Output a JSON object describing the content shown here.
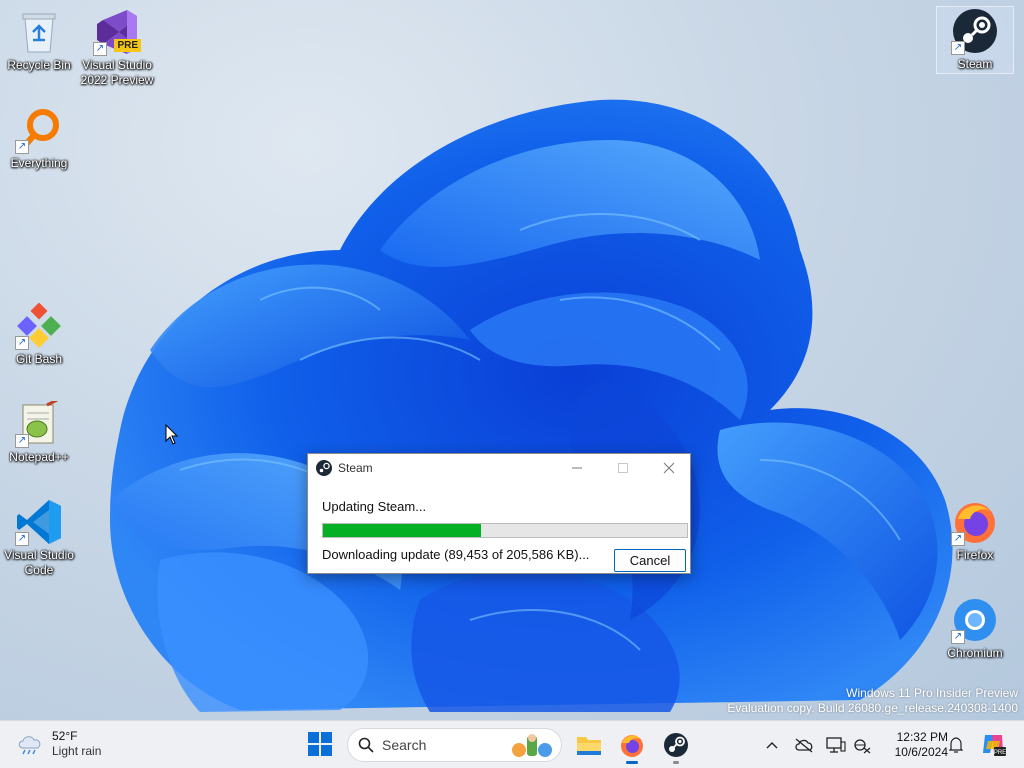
{
  "desktop": {
    "icons": [
      {
        "label": "Recycle Bin",
        "icon": "recycle-bin-icon"
      },
      {
        "label": "Visual Studio\n2022 Preview",
        "icon": "visual-studio-icon",
        "badge": "PRE"
      },
      {
        "label": "Everything",
        "icon": "everything-search-icon"
      },
      {
        "label": "Git Bash",
        "icon": "git-bash-icon"
      },
      {
        "label": "Notepad++",
        "icon": "notepad-plus-plus-icon"
      },
      {
        "label": "Visual Studio\nCode",
        "icon": "vscode-icon"
      },
      {
        "label": "Steam",
        "icon": "steam-icon"
      },
      {
        "label": "Firefox",
        "icon": "firefox-icon"
      },
      {
        "label": "Chromium",
        "icon": "chromium-icon"
      }
    ],
    "watermark": {
      "line1": "Windows 11 Pro Insider Preview",
      "line2": "Evaluation copy. Build 26080.ge_release.240308-1400"
    }
  },
  "steam_dialog": {
    "title": "Steam",
    "status": "Updating Steam...",
    "progress": 0.4351,
    "detail": "Downloading update (89,453 of 205,586 KB)...",
    "cancel_label": "Cancel",
    "progress_color": "#06b025"
  },
  "taskbar": {
    "weather": {
      "temp": "52°F",
      "condition": "Light rain"
    },
    "search_label": "Search",
    "apps": [
      "file-explorer-icon",
      "firefox-icon",
      "steam-icon"
    ],
    "tray_icons": [
      "chevron-up-icon",
      "onedrive-offline-icon",
      "display-icon",
      "network-icon"
    ],
    "clock": {
      "time": "12:32 PM",
      "date": "10/6/2024"
    }
  }
}
